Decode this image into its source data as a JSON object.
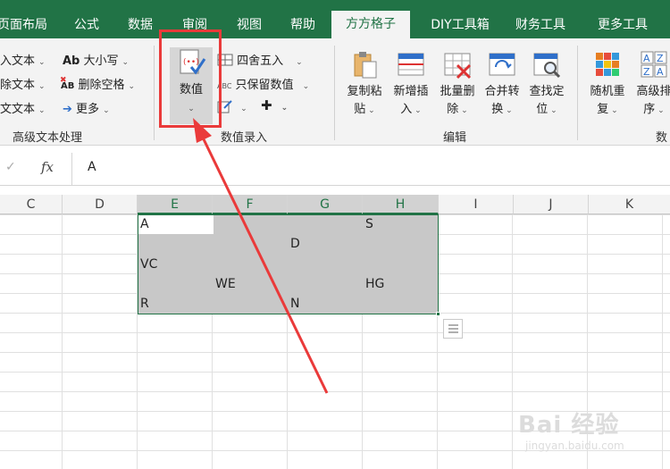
{
  "tabs": [
    {
      "label": "页面布局",
      "active": false
    },
    {
      "label": "公式",
      "active": false
    },
    {
      "label": "数据",
      "active": false
    },
    {
      "label": "审阅",
      "active": false
    },
    {
      "label": "视图",
      "active": false
    },
    {
      "label": "帮助",
      "active": false
    },
    {
      "label": "方方格子",
      "active": true
    },
    {
      "label": "DIY工具箱",
      "active": false
    },
    {
      "label": "财务工具",
      "active": false
    },
    {
      "label": "更多工具",
      "active": false
    }
  ],
  "ribbon": {
    "text_group": {
      "items": [
        "入文本",
        "除文本",
        "文文本"
      ],
      "case_button": "大小写",
      "remove_space_button": "删除空格",
      "more_button": "更多",
      "label": "高级文本处理"
    },
    "number_group": {
      "value_button": "数值",
      "round_button": "四舍五入",
      "keep_value_button": "只保留数值",
      "label": "数值录入"
    },
    "edit_group": {
      "buttons": [
        {
          "line1": "复制粘",
          "line2": "贴"
        },
        {
          "line1": "新增插",
          "line2": "入"
        },
        {
          "line1": "批量删",
          "line2": "除"
        },
        {
          "line1": "合并转",
          "line2": "换"
        },
        {
          "line1": "查找定",
          "line2": "位"
        }
      ],
      "label": "编辑"
    },
    "data_group": {
      "buttons": [
        {
          "line1": "随机重",
          "line2": "复"
        },
        {
          "line1": "高级排",
          "line2": "序"
        }
      ],
      "label": "数"
    }
  },
  "formula_bar": {
    "cancel_glyph": "✓",
    "fx_label": "fx",
    "value": "A"
  },
  "columns": [
    "C",
    "D",
    "E",
    "F",
    "G",
    "H",
    "I",
    "J",
    "K"
  ],
  "selected_columns": [
    "E",
    "F",
    "G",
    "H"
  ],
  "cells": [
    {
      "ref": "E1",
      "value": "A"
    },
    {
      "ref": "H1",
      "value": "S"
    },
    {
      "ref": "G2",
      "value": "D"
    },
    {
      "ref": "E3",
      "value": "VC"
    },
    {
      "ref": "F4",
      "value": "WE"
    },
    {
      "ref": "H4",
      "value": "HG"
    },
    {
      "ref": "E5",
      "value": "R"
    },
    {
      "ref": "G5",
      "value": "N"
    }
  ],
  "watermark": {
    "logo": "Bai 经验",
    "url": "jingyan.baidu.com"
  },
  "colors": {
    "ribbon_green": "#217346",
    "highlight_red": "#ea3a3a",
    "selection_gray": "#c8c8c8"
  }
}
